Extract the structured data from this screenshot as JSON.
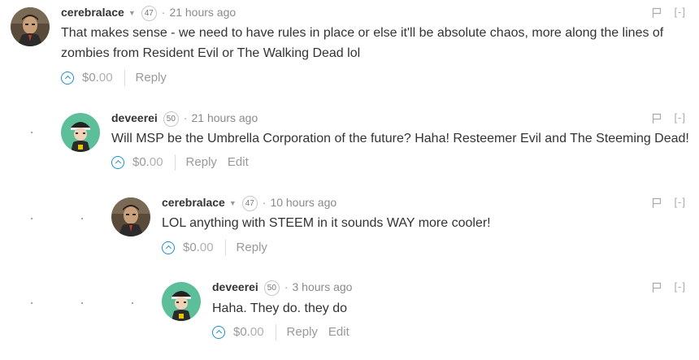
{
  "comments": [
    {
      "author": "cerebralace",
      "reputation": "47",
      "time": "21 hours ago",
      "text_line1": "That makes sense - we need to have rules in place or else it'll be absolute chaos, more along the lines of",
      "text_line2": "zombies from Resident Evil or The Walking Dead lol",
      "payout_main": "$0.",
      "payout_cents": "00",
      "reply_label": "Reply",
      "collapse_label": "[-]"
    },
    {
      "author": "deveerei",
      "reputation": "50",
      "time": "21 hours ago",
      "text_line1": "Will MSP be the Umbrella Corporation of the future? Haha! Resteemer Evil and The Steeming Dead!",
      "payout_main": "$0.",
      "payout_cents": "00",
      "reply_label": "Reply",
      "edit_label": "Edit",
      "collapse_label": "[-]"
    },
    {
      "author": "cerebralace",
      "reputation": "47",
      "time": "10 hours ago",
      "text_line1": "LOL anything with STEEM in it sounds WAY more cooler!",
      "payout_main": "$0.",
      "payout_cents": "00",
      "reply_label": "Reply",
      "collapse_label": "[-]"
    },
    {
      "author": "deveerei",
      "reputation": "50",
      "time": "3 hours ago",
      "text_line1": "Haha. They do. they do",
      "payout_main": "$0.",
      "payout_cents": "00",
      "reply_label": "Reply",
      "edit_label": "Edit",
      "collapse_label": "[-]"
    }
  ],
  "colors": {
    "accent": "#1a8fd1",
    "text": "#333333",
    "muted": "#999999"
  }
}
